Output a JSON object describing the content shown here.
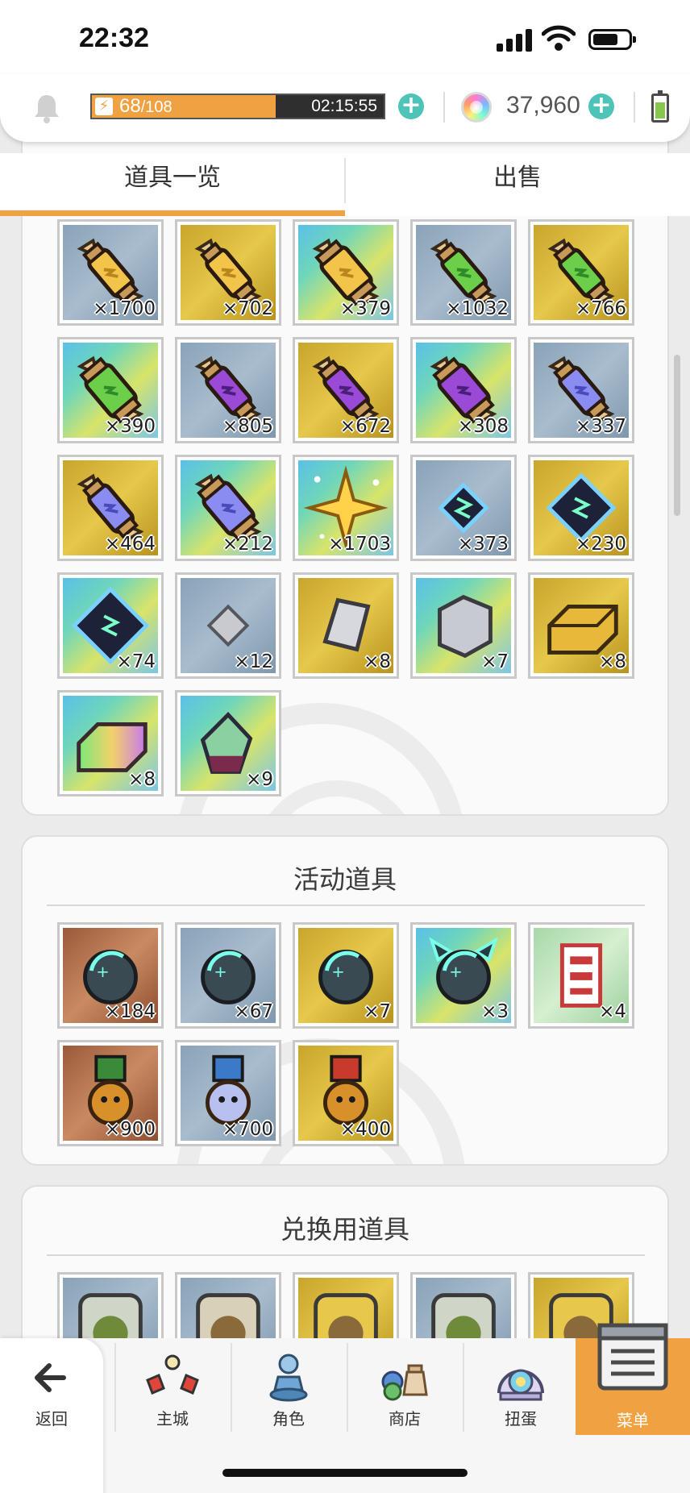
{
  "status_bar": {
    "time": "22:32"
  },
  "resources": {
    "stamina_current": "68",
    "stamina_max": "/108",
    "stamina_fraction": 0.63,
    "stamina_timer": "02:15:55",
    "gems": "37,960"
  },
  "tabs": [
    {
      "label": "道具一览",
      "active": true
    },
    {
      "label": "出售",
      "active": false
    }
  ],
  "panel_main": {
    "items": [
      {
        "icon": "yellow-potion-icon",
        "bg": "blue",
        "count": "×1700"
      },
      {
        "icon": "yellow-potion-icon",
        "bg": "gold",
        "count": "×702"
      },
      {
        "icon": "yellow-potion-large-icon",
        "bg": "rainbow",
        "count": "×379"
      },
      {
        "icon": "green-potion-icon",
        "bg": "blue",
        "count": "×1032"
      },
      {
        "icon": "green-potion-icon",
        "bg": "gold",
        "count": "×766"
      },
      {
        "icon": "green-potion-large-icon",
        "bg": "rainbow",
        "count": "×390"
      },
      {
        "icon": "purple-potion-icon",
        "bg": "blue",
        "count": "×805"
      },
      {
        "icon": "purple-potion-icon",
        "bg": "gold",
        "count": "×672"
      },
      {
        "icon": "purple-potion-large-icon",
        "bg": "rainbow",
        "count": "×308"
      },
      {
        "icon": "violet-potion-icon",
        "bg": "blue",
        "count": "×337"
      },
      {
        "icon": "violet-potion-icon",
        "bg": "gold",
        "count": "×464"
      },
      {
        "icon": "violet-potion-large-icon",
        "bg": "rainbow",
        "count": "×212"
      },
      {
        "icon": "gold-star-icon",
        "bg": "rainbow",
        "count": "×1703"
      },
      {
        "icon": "rune-crystal-small-icon",
        "bg": "blue",
        "count": "×373"
      },
      {
        "icon": "rune-crystal-icon",
        "bg": "gold",
        "count": "×230"
      },
      {
        "icon": "rune-crystal-large-icon",
        "bg": "rainbow",
        "count": "×74"
      },
      {
        "icon": "silver-shard-icon",
        "bg": "blue",
        "count": "×12"
      },
      {
        "icon": "silver-ore-icon",
        "bg": "gold",
        "count": "×8"
      },
      {
        "icon": "silver-chunk-icon",
        "bg": "rainbow",
        "count": "×7"
      },
      {
        "icon": "gold-ingot-icon",
        "bg": "gold",
        "count": "×8"
      },
      {
        "icon": "rainbow-ingot-icon",
        "bg": "rainbow",
        "count": "×8"
      },
      {
        "icon": "rainbow-gem-icon",
        "bg": "rainbow",
        "count": "×9"
      }
    ]
  },
  "panel_event": {
    "title": "活动道具",
    "items": [
      {
        "icon": "dark-orb-icon",
        "bg": "brown",
        "count": "×184"
      },
      {
        "icon": "dark-orb-icon",
        "bg": "blue",
        "count": "×67"
      },
      {
        "icon": "dark-orb-icon",
        "bg": "gold",
        "count": "×7"
      },
      {
        "icon": "dark-orb-horned-icon",
        "bg": "rainbow",
        "count": "×3"
      },
      {
        "icon": "red-ticket-icon",
        "bg": "green",
        "count": "×4"
      },
      {
        "icon": "cookie-medal-green-icon",
        "bg": "brown",
        "count": "×900"
      },
      {
        "icon": "ghost-medal-blue-icon",
        "bg": "blue",
        "count": "×700"
      },
      {
        "icon": "cookie-medal-red-icon",
        "bg": "gold",
        "count": "×400"
      }
    ]
  },
  "panel_exchange": {
    "title": "兑换用道具",
    "items": [
      {
        "icon": "green-badge-icon",
        "bg": "blue"
      },
      {
        "icon": "tan-badge-icon",
        "bg": "blue"
      },
      {
        "icon": "gold-badge-icon",
        "bg": "gold"
      },
      {
        "icon": "green-token-icon",
        "bg": "blue"
      },
      {
        "icon": "gold-token-icon",
        "bg": "gold"
      }
    ]
  },
  "bottom_nav": [
    {
      "label": "返回",
      "icon": "back-arrow-icon"
    },
    {
      "label": "主城",
      "icon": "town-icon"
    },
    {
      "label": "角色",
      "icon": "character-icon"
    },
    {
      "label": "商店",
      "icon": "shop-icon"
    },
    {
      "label": "扭蛋",
      "icon": "gacha-icon"
    },
    {
      "label": "菜单",
      "icon": "menu-icon",
      "active": true
    }
  ],
  "colors": {
    "accent": "#f0a242",
    "plus_button": "#4ec4b8"
  }
}
